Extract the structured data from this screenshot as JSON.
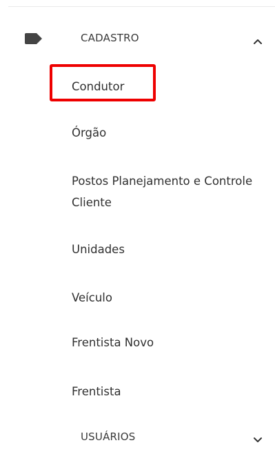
{
  "colors": {
    "highlight": "#ee0000",
    "text": "#2f2f2f",
    "icon": "#444444"
  },
  "sections": [
    {
      "label": "CADASTRO",
      "icon": "tag-icon",
      "state_icon": "chevron-up-icon",
      "expanded": true,
      "items": [
        {
          "label": "Condutor",
          "highlighted": true
        },
        {
          "label": "Órgão"
        },
        {
          "label": "Postos Planejamento e Controle Cliente"
        },
        {
          "label": "Unidades"
        },
        {
          "label": "Veículo"
        },
        {
          "label": "Frentista Novo"
        },
        {
          "label": "Frentista"
        }
      ]
    },
    {
      "label": "USUÁRIOS",
      "state_icon": "chevron-down-icon",
      "expanded": false
    }
  ]
}
